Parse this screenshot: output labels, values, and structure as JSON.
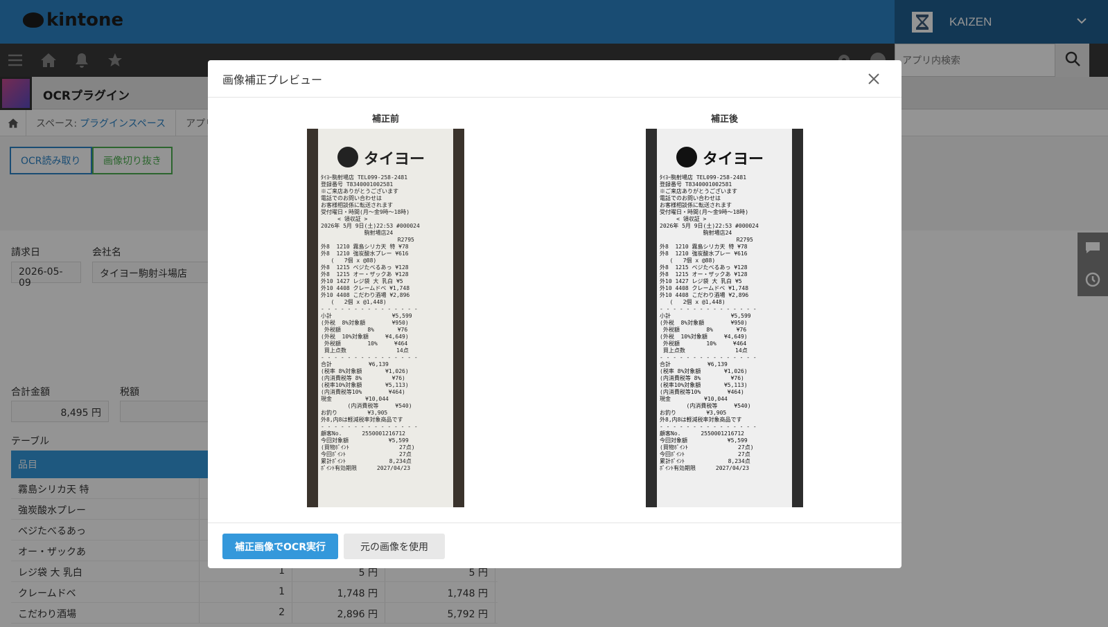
{
  "header": {
    "logo": "kintone",
    "user_name": "KAIZEN",
    "search_placeholder": "アプリ内検索"
  },
  "app": {
    "title": "OCRプラグイン"
  },
  "breadcrumb": {
    "space_prefix": "スペース:",
    "space_name": "プラグインスペース",
    "app_crumb": "アプリ"
  },
  "toolbar": {
    "ocr_button": "OCR読み取り",
    "crop_button": "画像切り抜き"
  },
  "record": {
    "date_label": "請求日",
    "date_value": "2026-05-09",
    "company_label": "会社名",
    "company_value": "タイヨー駒射斗場店",
    "total_label": "合計金額",
    "total_value": "8,495 円",
    "tax_label": "税額",
    "table_label": "テーブル",
    "table_header": "品目",
    "rows": [
      {
        "item": "霧島シリカ天 特",
        "qty": "",
        "price": "",
        "subtotal": ""
      },
      {
        "item": "強炭酸水プレー",
        "qty": "",
        "price": "",
        "subtotal": ""
      },
      {
        "item": "ベジたべるあっ",
        "qty": "",
        "price": "",
        "subtotal": ""
      },
      {
        "item": "オー・ザックあ",
        "qty": "",
        "price": "",
        "subtotal": ""
      },
      {
        "item": "レジ袋 大 乳白",
        "qty": "1",
        "price": "5 円",
        "subtotal": "5 円"
      },
      {
        "item": "クレームドベ",
        "qty": "1",
        "price": "1,748 円",
        "subtotal": "1,748 円"
      },
      {
        "item": "こだわり酒場",
        "qty": "2",
        "price": "2,896 円",
        "subtotal": "5,792 円"
      }
    ]
  },
  "modal": {
    "title": "画像補正プレビュー",
    "before_label": "補正前",
    "after_label": "補正後",
    "run_button": "補正画像でOCR実行",
    "original_button": "元の画像を使用"
  },
  "receipt": {
    "store_logo": "タイヨー",
    "lines": [
      "ﾀｲﾖｰ駒射場店 TEL099-258-2481",
      "登録番号 T8340001002581",
      "※ご来店ありがとうございます",
      "電話でのお問い合わせは",
      "お客様相談係に転送されます",
      "受付曜日・時間(月～金9時～18時)",
      "     < 領収証 >",
      "2026年 5月 9日(土)22:53 #000024",
      "             駒射場店24",
      "                       R2795",
      "外8  1210 霧島シリカ天 特 ¥78",
      "外8  1210 強炭酸水プレー ¥616",
      "   (   7個 x @88)",
      "外8  1215 ベジたべるあっ ¥128",
      "外8  1215 オー・ザックあ ¥128",
      "外10 1427 レジ袋 大 乳白 ¥5",
      "外10 4408 クレームドベ ¥1,748",
      "外10 4408 こだわり酒場 ¥2,896",
      "   (   2個 x @1,448)",
      "- - - - - - - - - - - - - - -",
      "小計                  ¥5,599",
      "(外税  8%対象額        ¥950)",
      " 外税額        8%       ¥76",
      "(外税  10%対象額     ¥4,649)",
      " 外税額        10%     ¥464",
      " 買上点数               14点",
      "- - - - - - - - - - - - - - -",
      "合計           ¥6,139",
      "(税率 8%対象額       ¥1,026)",
      "(内消費税等 8%         ¥76)",
      "(税率10%対象額       ¥5,113)",
      "(内消費税等10%        ¥464)",
      "現金          ¥10,044",
      "        (内消費税等     ¥540)",
      "お釣り         ¥3,905",
      "外8,内8は軽減税率対象商品です",
      "- - - - - - - - - - - - - - -",
      "顧客No.      2550001216712",
      "今回対象額            ¥5,599",
      "(買物ﾎﾟｲﾝﾄ               27点)",
      "今回ﾎﾟｲﾝﾄ                27点",
      "累計ﾎﾟｲﾝﾄ             8,234点",
      "ﾎﾟｲﾝﾄ有効期限      2027/04/23"
    ]
  },
  "colors": {
    "header_blue": "#2c83c6",
    "primary_button": "#3498db",
    "nav_dark": "#3a3a3a"
  }
}
